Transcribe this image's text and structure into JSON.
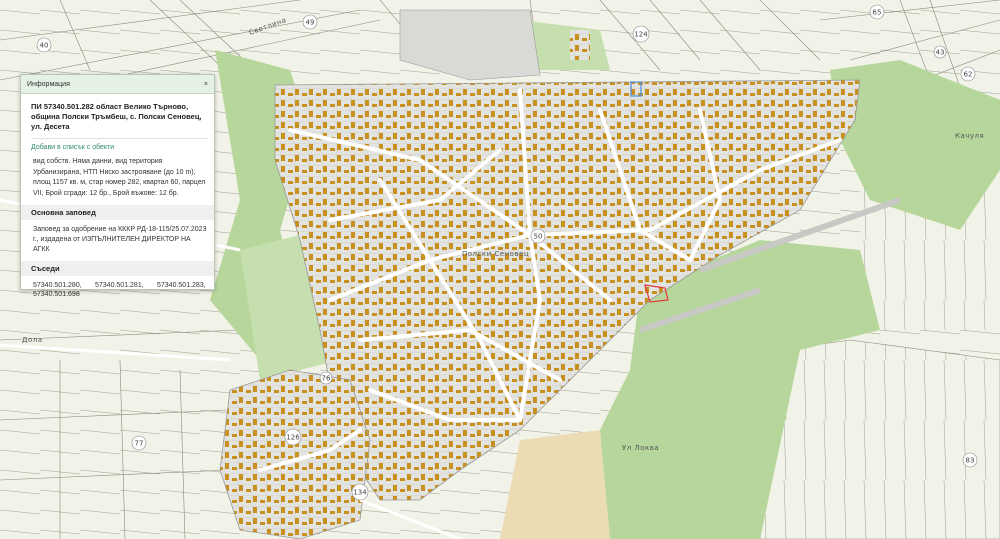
{
  "panel": {
    "header_title": "Информация",
    "close_glyph": "×",
    "title": "ПИ 57340.501.282 област Велико Търново, община Полски Тръмбеш, с. Полски Сеновец, ул. Десета",
    "add_link": "Добави в списък с обекти",
    "description": "вид собств. Няма данни, вид територия Урбанизирана, НТП Ниско застрояване (до 10 m), площ 1157 кв. м, стар номер 282, квартал 60, парцел VII, Брой сгради: 12 бр., Брой въжове: 12 бр.",
    "order_heading": "Основна заповед",
    "order_text": "Заповед за одобрение на КККР РД-18-115/25.07.2023 г., издадена от ИЗПЪЛНИТЕЛЕН ДИРЕКТОР НА АГКК",
    "neighbors_heading": "Съседи",
    "neighbors": [
      "57340.501.280,",
      "57340.501.281,",
      "57340.501.283,",
      "57340.501.698"
    ]
  },
  "map_labels": {
    "parcel_numbers": [
      "49",
      "40",
      "124",
      "65",
      "62",
      "77",
      "83",
      "126",
      "134",
      "76",
      "43"
    ],
    "street_names": [
      "Качуля",
      "Дола",
      "Ул Локва",
      "Светлина",
      "Полски Сеновец"
    ],
    "scale_label": "50"
  },
  "colors": {
    "urban_fill": "#dcdcdc",
    "building": "#c8911f",
    "forest": "#b7d69c",
    "agri": "#f0f2e6",
    "selected_parcel": "#e23b3b",
    "highlight": "#4a90e2",
    "sand": "#ecdcb4"
  }
}
